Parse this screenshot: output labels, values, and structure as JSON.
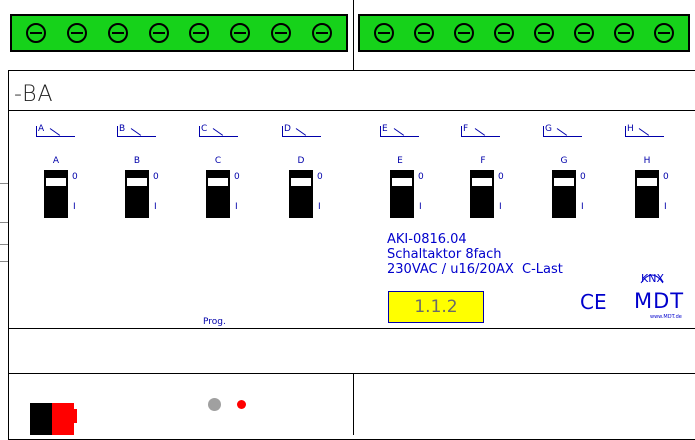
{
  "device_label": "-BA",
  "channels": [
    {
      "top_label": "A",
      "switch_label": "A"
    },
    {
      "top_label": "B",
      "switch_label": "B"
    },
    {
      "top_label": "C",
      "switch_label": "C"
    },
    {
      "top_label": "D",
      "switch_label": "D"
    },
    {
      "top_label": "E",
      "switch_label": "E"
    },
    {
      "top_label": "F",
      "switch_label": "F"
    },
    {
      "top_label": "G",
      "switch_label": "G"
    },
    {
      "top_label": "H",
      "switch_label": "H"
    }
  ],
  "switch_positions": {
    "upper": "0",
    "lower": "I"
  },
  "product": {
    "model": "AKI-0816.04",
    "name": "Schaltaktor 8fach",
    "rating": "230VAC / u16/20AX  C-Last"
  },
  "address": "1.1.2",
  "marks": {
    "ce": "CE",
    "knx": "KNX",
    "brand": "MDT",
    "url": "www.MDT.de"
  },
  "prog_label": "Prog.",
  "colors": {
    "terminal": "#16d21a",
    "address_bg": "#ffff00",
    "text_blue": "#0000cc",
    "led_red": "#ff0000",
    "led_grey": "#a0a0a0",
    "connector_red": "#ff0000"
  }
}
